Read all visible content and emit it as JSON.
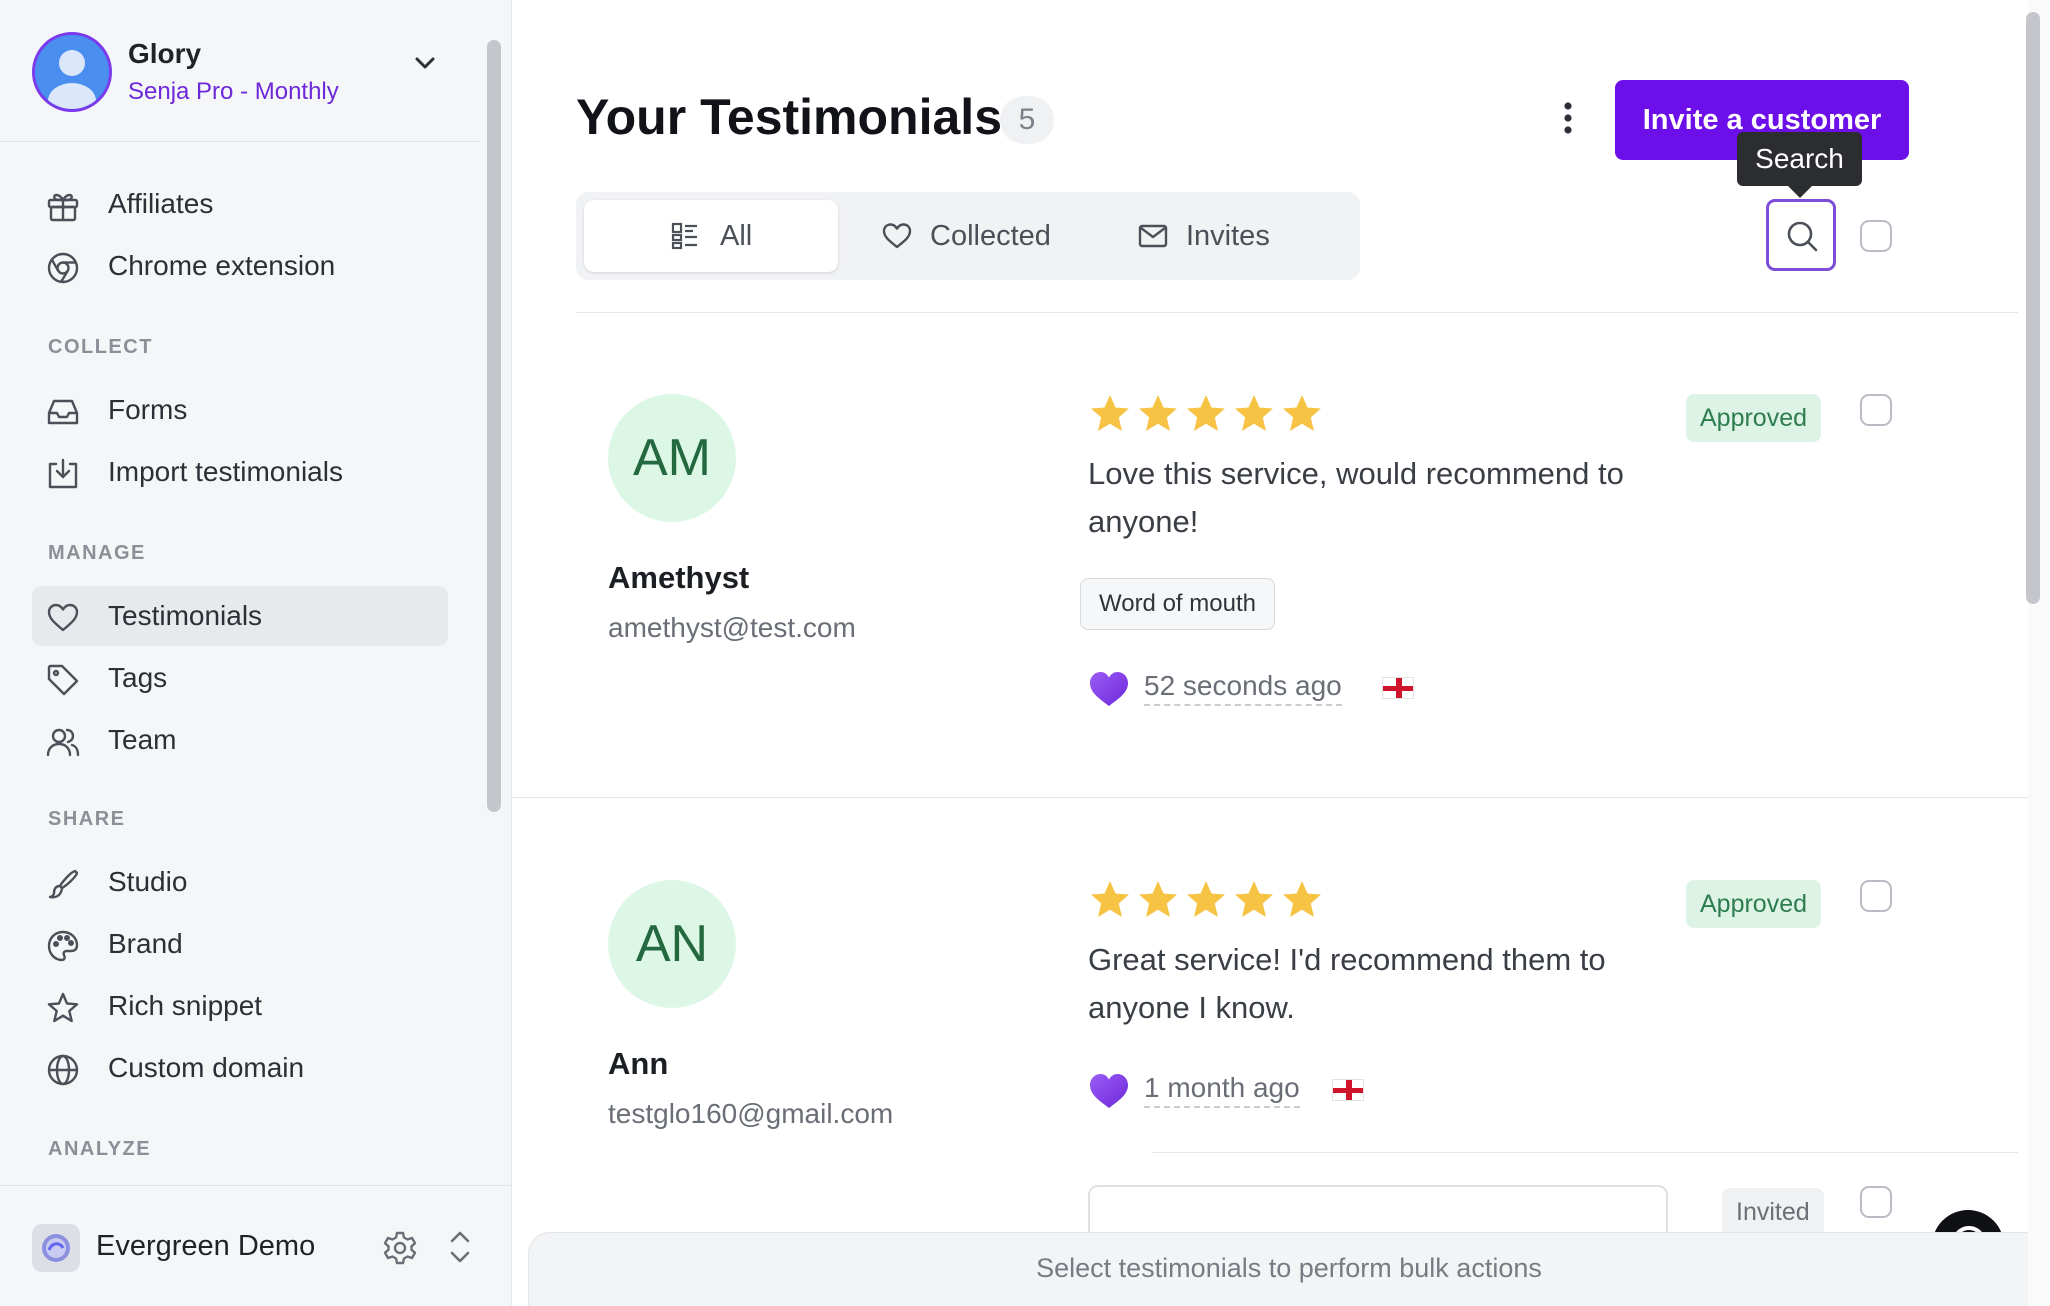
{
  "account": {
    "name": "Glory",
    "plan": "Senja Pro - Monthly"
  },
  "sidebar": {
    "top_items": [
      {
        "label": "Affiliates",
        "icon": "gift-icon"
      },
      {
        "label": "Chrome extension",
        "icon": "chrome-icon"
      }
    ],
    "sections": [
      {
        "title": "COLLECT",
        "items": [
          {
            "label": "Forms",
            "icon": "inbox-icon"
          },
          {
            "label": "Import testimonials",
            "icon": "import-icon"
          }
        ]
      },
      {
        "title": "MANAGE",
        "items": [
          {
            "label": "Testimonials",
            "icon": "heart-icon",
            "active": true
          },
          {
            "label": "Tags",
            "icon": "tag-icon"
          },
          {
            "label": "Team",
            "icon": "users-icon"
          }
        ]
      },
      {
        "title": "SHARE",
        "items": [
          {
            "label": "Studio",
            "icon": "brush-icon"
          },
          {
            "label": "Brand",
            "icon": "palette-icon"
          },
          {
            "label": "Rich snippet",
            "icon": "star-icon"
          },
          {
            "label": "Custom domain",
            "icon": "globe-icon"
          }
        ]
      },
      {
        "title": "ANALYZE",
        "items": []
      }
    ],
    "workspace": {
      "name": "Evergreen Demo"
    }
  },
  "header": {
    "title": "Your Testimonials",
    "count": "5",
    "invite_button": "Invite a customer",
    "search_tooltip": "Search"
  },
  "tabs": [
    {
      "label": "All",
      "icon": "grid-list-icon",
      "active": true
    },
    {
      "label": "Collected",
      "icon": "heart-icon"
    },
    {
      "label": "Invites",
      "icon": "mail-icon"
    }
  ],
  "testimonials": [
    {
      "initials": "AM",
      "name": "Amethyst",
      "email": "amethyst@test.com",
      "rating": 5,
      "text": "Love this service, would recommend to anyone!",
      "tag": "Word of mouth",
      "time": "52 seconds ago",
      "status": "Approved"
    },
    {
      "initials": "AN",
      "name": "Ann",
      "email": "testglo160@gmail.com",
      "rating": 5,
      "text": "Great service! I'd recommend them to anyone I know.",
      "time": "1 month ago",
      "status": "Approved"
    }
  ],
  "invite_row": {
    "status": "Invited"
  },
  "bulk_bar": {
    "text": "Select testimonials to perform bulk actions"
  },
  "colors": {
    "accent": "#6d0fe8",
    "approved_bg": "#ddf3e6",
    "approved_text": "#2e7d4f",
    "star": "#f6c344",
    "heart": "#7c3aed"
  }
}
